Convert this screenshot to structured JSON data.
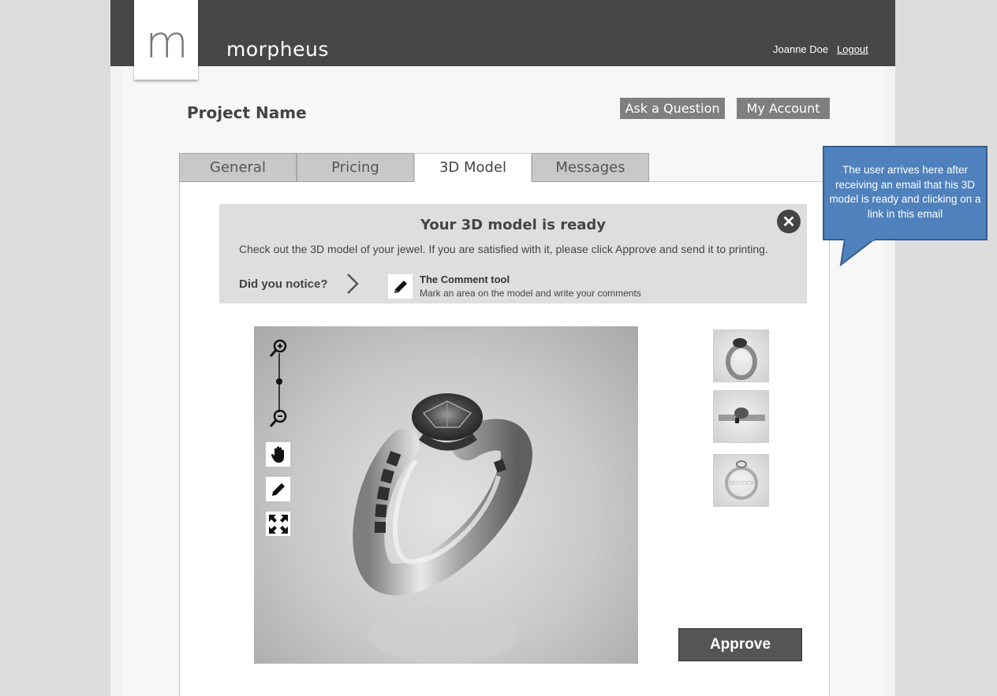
{
  "brand": {
    "logo_letter": "m",
    "name": "morpheus"
  },
  "header": {
    "user_name": "Joanne Doe",
    "logout_label": "Logout"
  },
  "project": {
    "title": "Project Name"
  },
  "actions": {
    "ask_label": "Ask a Question",
    "account_label": "My Account"
  },
  "tabs": [
    {
      "label": "General",
      "active": false
    },
    {
      "label": "Pricing",
      "active": false
    },
    {
      "label": "3D Model",
      "active": true
    },
    {
      "label": "Messages",
      "active": false
    }
  ],
  "notice": {
    "title": "Your 3D model is ready",
    "text": "Check out the 3D model of your jewel. If you are satisfied with it, please click Approve and send it to printing.",
    "did_you_notice": "Did you notice?",
    "tool_title": "The Comment tool",
    "tool_desc": "Mark an area on the model and write your comments",
    "close_icon": "close-icon"
  },
  "viewer": {
    "tools": [
      "zoom-in-icon",
      "zoom-slider",
      "zoom-out-icon",
      "hand-icon",
      "pencil-icon",
      "fullscreen-icon"
    ],
    "thumbnails": [
      "ring-perspective",
      "ring-side",
      "ring-top"
    ],
    "thumb3_watermark": "BESTOCK"
  },
  "approve_label": "Approve",
  "callout": {
    "text": "The user arrives here after receiving an email that his 3D model is ready and clicking on a link in this email"
  },
  "colors": {
    "topbar": "#474747",
    "callout": "#4f81bd",
    "button": "#7f7f7f"
  }
}
